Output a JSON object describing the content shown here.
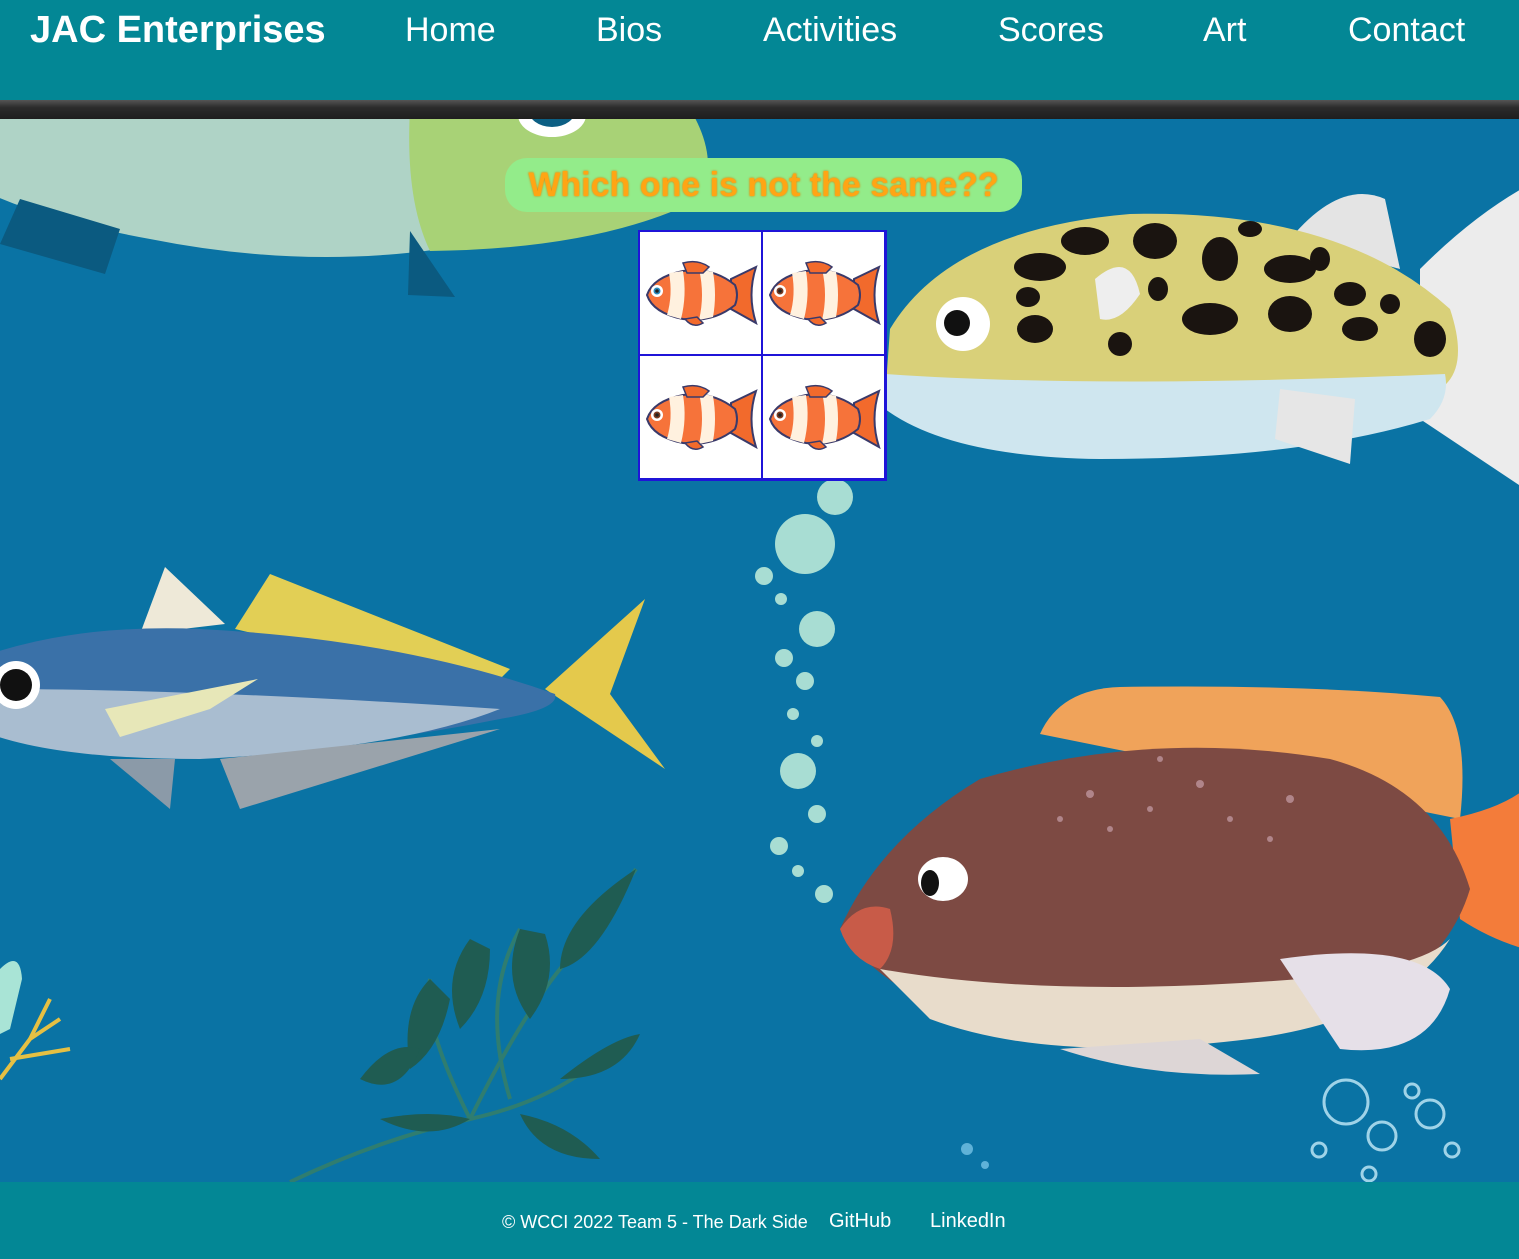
{
  "header": {
    "brand": "JAC Enterprises",
    "nav": [
      {
        "label": "Home"
      },
      {
        "label": "Bios"
      },
      {
        "label": "Activities"
      },
      {
        "label": "Scores"
      },
      {
        "label": "Art"
      },
      {
        "label": "Contact"
      }
    ]
  },
  "puzzle": {
    "question": "Which one is not the same??",
    "tiles": [
      "clownfish-icon",
      "clownfish-icon",
      "clownfish-icon",
      "clownfish-icon"
    ]
  },
  "footer": {
    "copyright": "© WCCI 2022 Team 5 - The Dark Side",
    "github_label": "GitHub",
    "linkedin_label": "LinkedIn"
  },
  "colors": {
    "header_bg": "#038795",
    "ocean": "#0a73a4",
    "question_bg": "#93ec8a",
    "question_text": "#ffa514",
    "grid_border": "#1f14d8"
  }
}
